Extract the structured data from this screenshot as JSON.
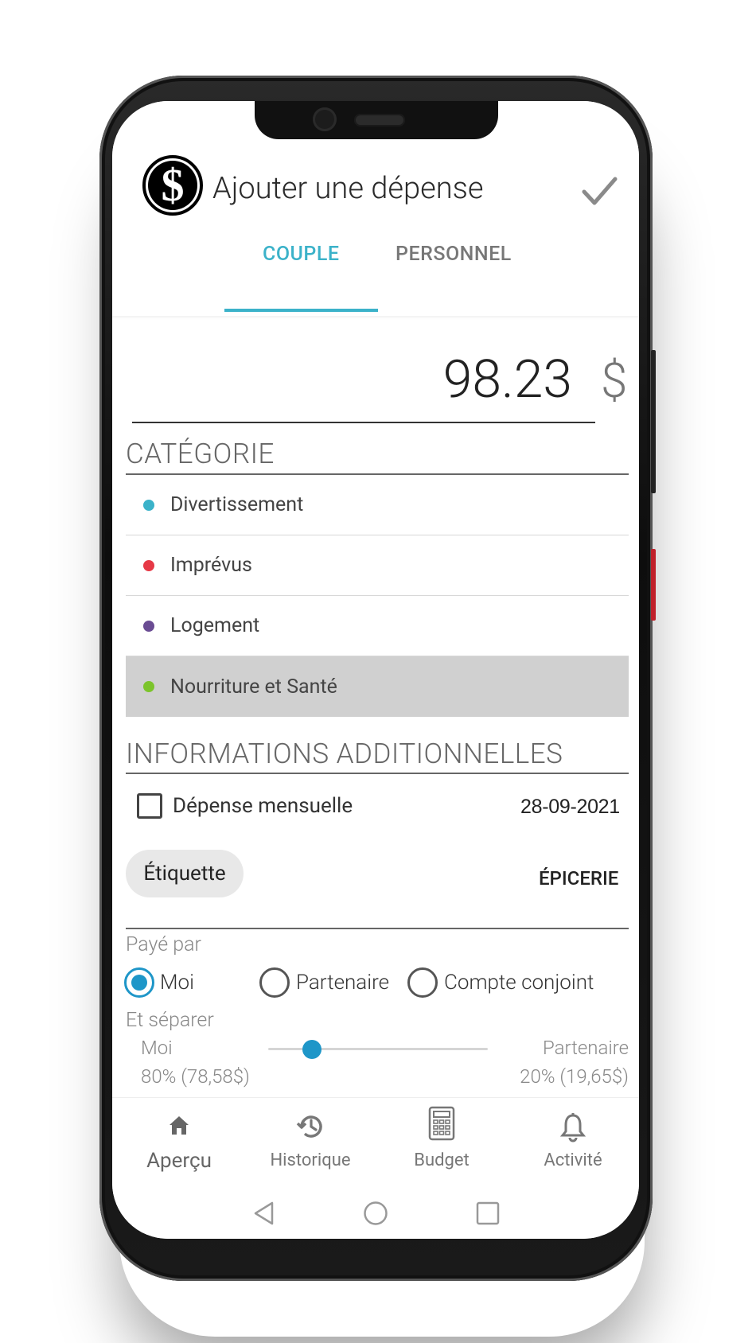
{
  "header": {
    "title": "Ajouter une dépense",
    "logo_glyph": "$",
    "confirm_icon": "check-icon"
  },
  "tabs": [
    {
      "label": "COUPLE",
      "active": true
    },
    {
      "label": "PERSONNEL",
      "active": false
    }
  ],
  "amount": {
    "value": "98.23",
    "currency": "$"
  },
  "category": {
    "title": "CATÉGORIE",
    "items": [
      {
        "label": "Divertissement",
        "color": "#3bb2c9",
        "selected": false
      },
      {
        "label": "Imprévus",
        "color": "#e63946",
        "selected": false
      },
      {
        "label": "Logement",
        "color": "#6a4c93",
        "selected": false
      },
      {
        "label": "Nourriture et Santé",
        "color": "#7cc42b",
        "selected": true
      }
    ]
  },
  "additional": {
    "title": "INFORMATIONS ADDITIONNELLES",
    "monthly_label": "Dépense mensuelle",
    "monthly_checked": false,
    "date": "28-09-2021",
    "tag_chip": "Étiquette",
    "tag_value": "ÉPICERIE"
  },
  "paid_by": {
    "label": "Payé par",
    "options": [
      {
        "label": "Moi",
        "selected": true
      },
      {
        "label": "Partenaire",
        "selected": false
      },
      {
        "label": "Compte conjoint",
        "selected": false
      }
    ]
  },
  "split": {
    "label": "Et séparer",
    "left_name": "Moi",
    "left_value": "80% (78,58$)",
    "right_name": "Partenaire",
    "right_value": "20% (19,65$)",
    "ratio_left": 0.8
  },
  "bottom_nav": [
    {
      "label": "Aperçu",
      "icon": "home-icon",
      "active": true
    },
    {
      "label": "Historique",
      "icon": "history-icon",
      "active": false
    },
    {
      "label": "Budget",
      "icon": "calculator-icon",
      "active": false
    },
    {
      "label": "Activité",
      "icon": "bell-icon",
      "active": false
    }
  ],
  "system_nav": [
    "back-icon",
    "home-circle-icon",
    "recents-icon"
  ],
  "colors": {
    "accent": "#3bb2c9",
    "radio": "#1e96c8",
    "selected_row": "#d0d0d0"
  }
}
